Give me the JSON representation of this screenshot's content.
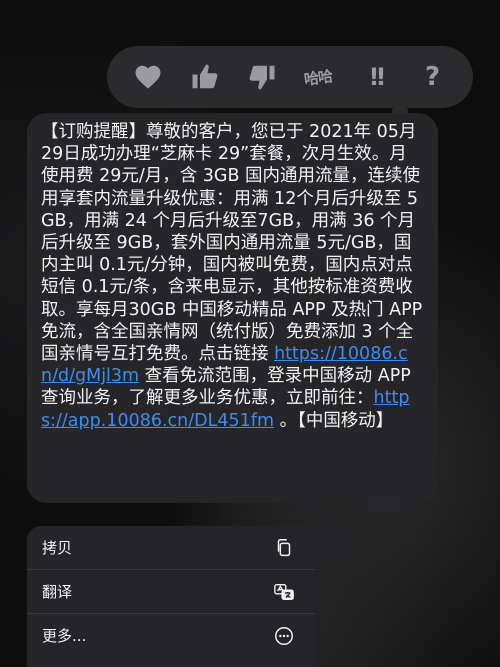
{
  "tapback": {
    "reactions": [
      {
        "name": "heart-icon"
      },
      {
        "name": "thumbs-up-icon"
      },
      {
        "name": "thumbs-down-icon"
      },
      {
        "name": "haha-icon",
        "text": "哈哈"
      },
      {
        "name": "exclamation-icon",
        "text": "!!"
      },
      {
        "name": "question-icon",
        "text": "?"
      }
    ]
  },
  "message": {
    "part1": "【订购提醒】尊敬的客户，您已于 2021年 05月29日成功办理“芝麻卡 29”套餐，次月生效。月使用费 29元/月，含 3GB 国内通用流量，连续使用享套内流量升级优惠：用满 12个月后升级至 5GB，用满 24 个月后升级至7GB，用满 36 个月后升级至 9GB，套外国内通用流量 5元/GB，国内主叫 0.1元/分钟，国内被叫免费，国内点对点短信 0.1元/条，含来电显示，其他按标准资费收取。享每月30GB 中国移动精品 APP 及热门 APP 免流，含全国亲情网（统付版）免费添加 3 个全国亲情号互打免费。点击链接 ",
    "link1": "https://10086.cn/d/gMjl3m",
    "part2": " 查看免流范围，登录中国移动 APP 查询业务，了解更多业务优惠，立即前往：",
    "link2": "https://app.10086.cn/DL451fm",
    "part3": " 。【中国移动】"
  },
  "menu": {
    "items": [
      {
        "label": "拷贝",
        "icon": "copy-icon"
      },
      {
        "label": "翻译",
        "icon": "translate-icon"
      },
      {
        "label": "更多...",
        "icon": "more-icon"
      }
    ]
  }
}
